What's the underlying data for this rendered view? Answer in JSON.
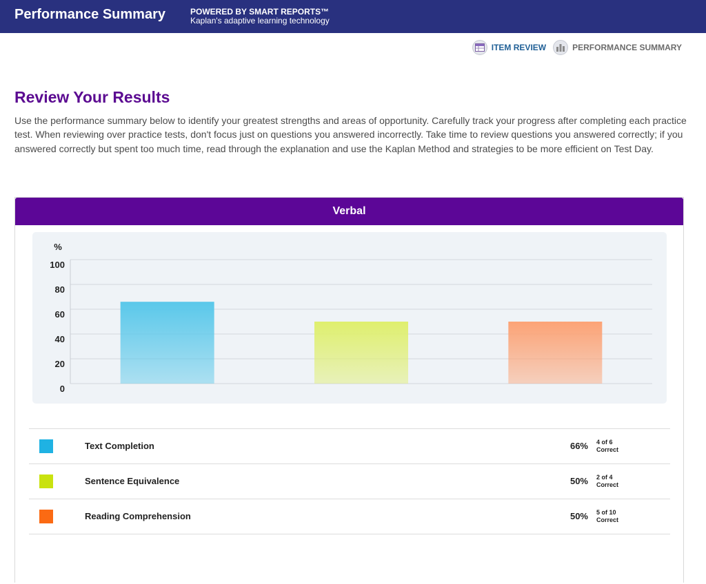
{
  "header": {
    "title": "Performance Summary",
    "powered_by": "POWERED BY SMART REPORTS™",
    "subtitle": "Kaplan's adaptive learning technology"
  },
  "nav": {
    "item_review": {
      "label": "ITEM REVIEW",
      "icon": "item-review-icon"
    },
    "performance_summary": {
      "label": "PERFORMANCE SUMMARY",
      "icon": "performance-summary-icon"
    }
  },
  "main": {
    "heading": "Review Your Results",
    "intro": "Use the performance summary below to identify your greatest strengths and areas of opportunity. Carefully track your progress after completing each practice test. When reviewing over practice tests, don't focus just on questions you answered incorrectly. Take time to review questions you answered correctly; if you answered correctly but spent too much time, read through the explanation and use the Kaplan Method and strategies to be more efficient on Test Day."
  },
  "section": {
    "title": "Verbal"
  },
  "chart_data": {
    "type": "bar",
    "ylabel": "%",
    "ylim": [
      0,
      100
    ],
    "yticks": [
      "100",
      "80",
      "60",
      "40",
      "20",
      "0"
    ],
    "categories": [
      "Text Completion",
      "Sentence Equivalence",
      "Reading Comprehension"
    ],
    "values": [
      66,
      50,
      50
    ],
    "colors": [
      "#5ac8ea",
      "#dfef6e",
      "#fca376"
    ],
    "grid": true
  },
  "legend": [
    {
      "label": "Text Completion",
      "color": "#1fb2e3",
      "percent": "66%",
      "score_line1": "4 of 6",
      "score_line2": "Correct"
    },
    {
      "label": "Sentence Equivalence",
      "color": "#c9e20f",
      "percent": "50%",
      "score_line1": "2 of 4",
      "score_line2": "Correct"
    },
    {
      "label": "Reading Comprehension",
      "color": "#fb6a13",
      "percent": "50%",
      "score_line1": "5 of 10",
      "score_line2": "Correct"
    }
  ]
}
